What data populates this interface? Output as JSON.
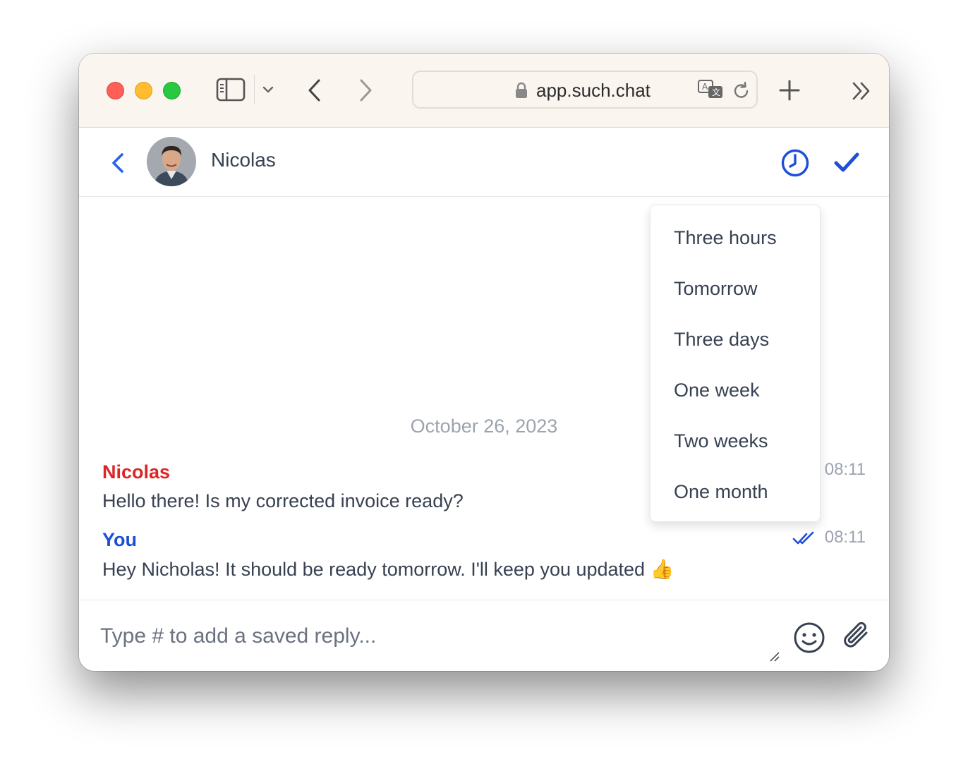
{
  "browser": {
    "url": "app.such.chat"
  },
  "chat": {
    "contact_name": "Nicolas",
    "date_separator": "October 26, 2023",
    "messages": [
      {
        "sender": "Nicolas",
        "text": "Hello there! Is my corrected invoice ready?",
        "time": "08:11",
        "sender_color": "#dc2626"
      },
      {
        "sender": "You",
        "text": "Hey Nicholas! It should be ready tomorrow. I'll keep you updated 👍",
        "time": "08:11",
        "sender_color": "#1d4ed8",
        "status": "read-double-check-icon"
      }
    ]
  },
  "snooze_menu": {
    "items": [
      "Three hours",
      "Tomorrow",
      "Three days",
      "One week",
      "Two weeks",
      "One month"
    ]
  },
  "composer": {
    "placeholder": "Type # to add a saved reply..."
  },
  "colors": {
    "accent": "#1d4ed8",
    "toolbar_bg": "#fbf5f0"
  }
}
